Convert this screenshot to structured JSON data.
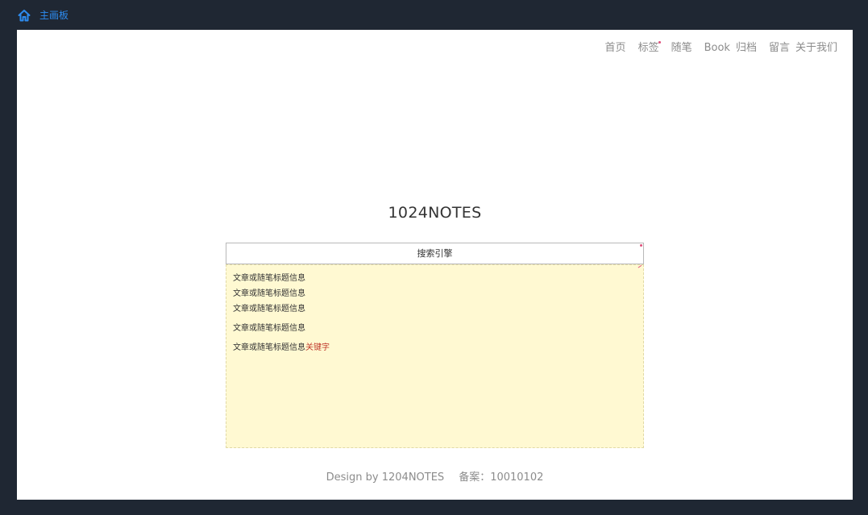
{
  "breadcrumb": {
    "icon": "home-icon",
    "label": "主画板"
  },
  "nav": {
    "items": [
      "首页",
      "标签",
      "随笔",
      "Book",
      "归档",
      "留言",
      "关于我们"
    ]
  },
  "site": {
    "title": "1024NOTES"
  },
  "search": {
    "placeholder": "搜索引擎",
    "value": ""
  },
  "results": {
    "items": [
      "文章或随笔标题信息",
      "文章或随笔标题信息",
      "文章或随笔标题信息",
      "文章或随笔标题信息",
      "文章或随笔标题信息"
    ],
    "keyword": "关键字"
  },
  "footer": {
    "design": "Design by 1204NOTES",
    "record": "备案：10010102"
  },
  "colors": {
    "frame": "#1f2733",
    "accent": "#2d8cf0",
    "nav_text": "#8c8c8c",
    "results_bg": "#fff9d2",
    "keyword": "#c0392b",
    "marker": "#e0507a"
  }
}
